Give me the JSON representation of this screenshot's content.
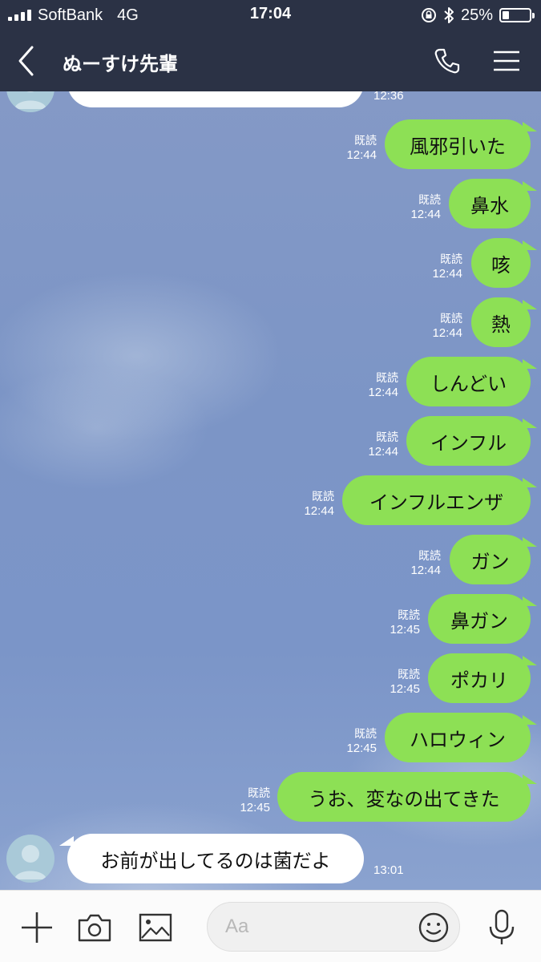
{
  "status_bar": {
    "carrier": "SoftBank",
    "network": "4G",
    "time": "17:04",
    "battery_percent_label": "25%",
    "battery_level": 0.25
  },
  "header": {
    "title": "ぬーすけ先輩",
    "back_icon": "chevron-left-icon",
    "call_icon": "phone-icon",
    "menu_icon": "hamburger-menu-icon"
  },
  "chat": {
    "top_partial": {
      "text": "",
      "time": "12:36"
    },
    "sent_messages": [
      {
        "text": "風邪引いた",
        "read": "既読",
        "time": "12:44"
      },
      {
        "text": "鼻水",
        "read": "既読",
        "time": "12:44"
      },
      {
        "text": "咳",
        "read": "既読",
        "time": "12:44"
      },
      {
        "text": "熱",
        "read": "既読",
        "time": "12:44"
      },
      {
        "text": "しんどい",
        "read": "既読",
        "time": "12:44"
      },
      {
        "text": "インフル",
        "read": "既読",
        "time": "12:44"
      },
      {
        "text": "インフルエンザ",
        "read": "既読",
        "time": "12:44"
      },
      {
        "text": "ガン",
        "read": "既読",
        "time": "12:44"
      },
      {
        "text": "鼻ガン",
        "read": "既読",
        "time": "12:45"
      },
      {
        "text": "ポカリ",
        "read": "既読",
        "time": "12:45"
      },
      {
        "text": "ハロウィン",
        "read": "既読",
        "time": "12:45"
      },
      {
        "text": "うお、変なの出てきた",
        "read": "既読",
        "time": "12:45"
      }
    ],
    "received_last": {
      "text": "お前が出してるのは菌だよ",
      "time": "13:01"
    }
  },
  "input_bar": {
    "placeholder": "Aa",
    "icons": [
      "plus-icon",
      "camera-icon",
      "image-icon",
      "emoji-icon",
      "microphone-icon"
    ]
  },
  "colors": {
    "header_bg": "#2b3245",
    "sent_bubble": "#8de055",
    "received_bubble": "#ffffff",
    "chat_bg": "#7e97c8"
  }
}
